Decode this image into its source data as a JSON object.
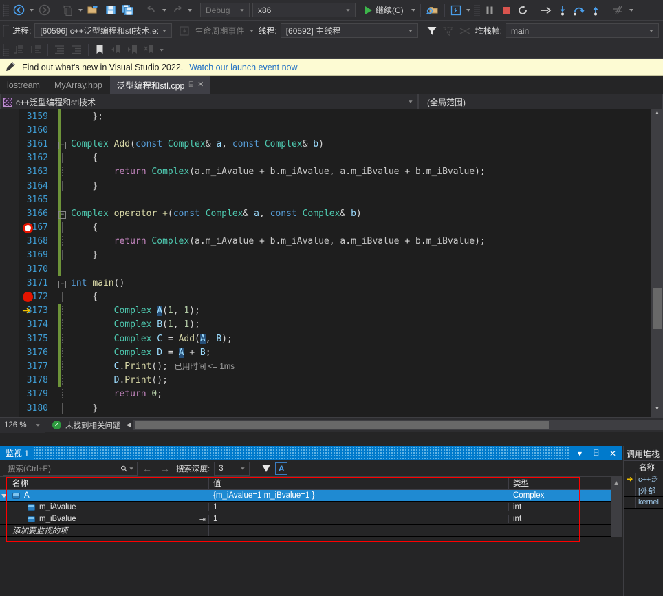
{
  "toolbar_main": {
    "nav_back": "navigate-back",
    "nav_forward": "navigate-forward",
    "new_item": "new-item",
    "open_file": "open-file",
    "save": "save",
    "save_all": "save-all",
    "undo": "undo",
    "redo": "redo",
    "config": "Debug",
    "platform": "x86",
    "continue_label": "继续(C)",
    "attach": "attach-to-process",
    "hot_reload": "hot-reload",
    "break_all": "break-all",
    "stop": "stop-debugging",
    "restart": "restart",
    "show_next": "show-next-statement",
    "step_into": "step-into",
    "step_over": "step-over",
    "step_out": "step-out",
    "threads_win": "threads-window"
  },
  "toolbar_debug": {
    "process_label": "进程:",
    "process_value": "[60596] c++泛型编程和stl技术.e:",
    "lifecycle_label": "生命周期事件",
    "thread_label": "线程:",
    "thread_value": "[60592] 主线程",
    "stackframe_label": "堆栈帧:",
    "stackframe_value": "main"
  },
  "toolbar_text": {
    "comment": "comment-selection",
    "uncomment": "uncomment-selection",
    "indent": "increase-indent",
    "outdent": "decrease-indent",
    "bookmark": "toggle-bookmark",
    "prev_bookmark": "previous-bookmark",
    "next_bookmark": "next-bookmark",
    "clear_bookmarks": "clear-bookmarks"
  },
  "notification": {
    "text": "Find out what's new in Visual Studio 2022.",
    "link": "Watch our launch event now"
  },
  "tabs": [
    {
      "label": "iostream",
      "active": false
    },
    {
      "label": "MyArray.hpp",
      "active": false
    },
    {
      "label": "泛型编程和stl.cpp",
      "active": true
    }
  ],
  "navbar": {
    "project": "c++泛型编程和stl技术",
    "scope": "(全局范围)"
  },
  "editor": {
    "zoom": "126 %",
    "status": "未找到相关问题",
    "lines": [
      {
        "num": "3159",
        "changed": true,
        "marker": "",
        "fold": "",
        "guide": "",
        "tokens": [
          {
            "c": "p",
            "t": "};"
          }
        ],
        "indent": 1
      },
      {
        "num": "3160",
        "changed": true,
        "marker": "",
        "fold": "",
        "guide": "",
        "tokens": [],
        "indent": 0
      },
      {
        "num": "3161",
        "changed": true,
        "marker": "",
        "fold": "-",
        "guide": "",
        "tokens": [
          {
            "c": "t",
            "t": "Complex"
          },
          {
            "c": "p",
            "t": " "
          },
          {
            "c": "f",
            "t": "Add"
          },
          {
            "c": "p",
            "t": "("
          },
          {
            "c": "k",
            "t": "const"
          },
          {
            "c": "p",
            "t": " "
          },
          {
            "c": "t",
            "t": "Complex"
          },
          {
            "c": "p",
            "t": "& "
          },
          {
            "c": "v",
            "t": "a"
          },
          {
            "c": "p",
            "t": ", "
          },
          {
            "c": "k",
            "t": "const"
          },
          {
            "c": "p",
            "t": " "
          },
          {
            "c": "t",
            "t": "Complex"
          },
          {
            "c": "p",
            "t": "& "
          },
          {
            "c": "v",
            "t": "b"
          },
          {
            "c": "p",
            "t": ")"
          }
        ],
        "indent": 0
      },
      {
        "num": "3162",
        "changed": true,
        "marker": "",
        "fold": "",
        "guide": "solid",
        "tokens": [
          {
            "c": "p",
            "t": "{"
          }
        ],
        "indent": 1
      },
      {
        "num": "3163",
        "changed": true,
        "marker": "",
        "fold": "",
        "guide": "dash",
        "tokens": [
          {
            "c": "kr",
            "t": "return"
          },
          {
            "c": "p",
            "t": " "
          },
          {
            "c": "t",
            "t": "Complex"
          },
          {
            "c": "p",
            "t": "("
          },
          {
            "c": "m",
            "t": "a"
          },
          {
            "c": "p",
            "t": "."
          },
          {
            "c": "m",
            "t": "m_iAvalue"
          },
          {
            "c": "p",
            "t": " + "
          },
          {
            "c": "m",
            "t": "b"
          },
          {
            "c": "p",
            "t": "."
          },
          {
            "c": "m",
            "t": "m_iAvalue"
          },
          {
            "c": "p",
            "t": ", "
          },
          {
            "c": "m",
            "t": "a"
          },
          {
            "c": "p",
            "t": "."
          },
          {
            "c": "m",
            "t": "m_iBvalue"
          },
          {
            "c": "p",
            "t": " + "
          },
          {
            "c": "m",
            "t": "b"
          },
          {
            "c": "p",
            "t": "."
          },
          {
            "c": "m",
            "t": "m_iBvalue"
          },
          {
            "c": "p",
            "t": ");"
          }
        ],
        "indent": 2
      },
      {
        "num": "3164",
        "changed": true,
        "marker": "",
        "fold": "",
        "guide": "solid",
        "tokens": [
          {
            "c": "p",
            "t": "}"
          }
        ],
        "indent": 1
      },
      {
        "num": "3165",
        "changed": true,
        "marker": "",
        "fold": "",
        "guide": "",
        "tokens": [],
        "indent": 0
      },
      {
        "num": "3166",
        "changed": true,
        "marker": "",
        "fold": "-",
        "guide": "",
        "tokens": [
          {
            "c": "t",
            "t": "Complex"
          },
          {
            "c": "p",
            "t": " "
          },
          {
            "c": "f",
            "t": "operator +"
          },
          {
            "c": "p",
            "t": "("
          },
          {
            "c": "k",
            "t": "const"
          },
          {
            "c": "p",
            "t": " "
          },
          {
            "c": "t",
            "t": "Complex"
          },
          {
            "c": "p",
            "t": "& "
          },
          {
            "c": "v",
            "t": "a"
          },
          {
            "c": "p",
            "t": ", "
          },
          {
            "c": "k",
            "t": "const"
          },
          {
            "c": "p",
            "t": " "
          },
          {
            "c": "t",
            "t": "Complex"
          },
          {
            "c": "p",
            "t": "& "
          },
          {
            "c": "v",
            "t": "b"
          },
          {
            "c": "p",
            "t": ")"
          }
        ],
        "indent": 0
      },
      {
        "num": "3167",
        "changed": true,
        "marker": "hollow",
        "fold": "",
        "guide": "solid",
        "tokens": [
          {
            "c": "p",
            "t": "{"
          }
        ],
        "indent": 1
      },
      {
        "num": "3168",
        "changed": true,
        "marker": "",
        "fold": "",
        "guide": "dash",
        "tokens": [
          {
            "c": "kr",
            "t": "return"
          },
          {
            "c": "p",
            "t": " "
          },
          {
            "c": "t",
            "t": "Complex"
          },
          {
            "c": "p",
            "t": "("
          },
          {
            "c": "m",
            "t": "a"
          },
          {
            "c": "p",
            "t": "."
          },
          {
            "c": "m",
            "t": "m_iAvalue"
          },
          {
            "c": "p",
            "t": " + "
          },
          {
            "c": "m",
            "t": "b"
          },
          {
            "c": "p",
            "t": "."
          },
          {
            "c": "m",
            "t": "m_iAvalue"
          },
          {
            "c": "p",
            "t": ", "
          },
          {
            "c": "m",
            "t": "a"
          },
          {
            "c": "p",
            "t": "."
          },
          {
            "c": "m",
            "t": "m_iBvalue"
          },
          {
            "c": "p",
            "t": " + "
          },
          {
            "c": "m",
            "t": "b"
          },
          {
            "c": "p",
            "t": "."
          },
          {
            "c": "m",
            "t": "m_iBvalue"
          },
          {
            "c": "p",
            "t": ");"
          }
        ],
        "indent": 2
      },
      {
        "num": "3169",
        "changed": true,
        "marker": "",
        "fold": "",
        "guide": "solid",
        "tokens": [
          {
            "c": "p",
            "t": "}"
          }
        ],
        "indent": 1
      },
      {
        "num": "3170",
        "changed": true,
        "marker": "",
        "fold": "",
        "guide": "",
        "tokens": [],
        "indent": 0
      },
      {
        "num": "3171",
        "changed": false,
        "marker": "",
        "fold": "-",
        "guide": "",
        "tokens": [
          {
            "c": "k",
            "t": "int"
          },
          {
            "c": "p",
            "t": " "
          },
          {
            "c": "f",
            "t": "main"
          },
          {
            "c": "p",
            "t": "()"
          }
        ],
        "indent": 0
      },
      {
        "num": "3172",
        "changed": false,
        "marker": "full",
        "fold": "",
        "guide": "solid",
        "tokens": [
          {
            "c": "p",
            "t": "{"
          }
        ],
        "indent": 1
      },
      {
        "num": "3173",
        "changed": true,
        "marker": "arrow",
        "fold": "",
        "guide": "dash",
        "tokens": [
          {
            "c": "t",
            "t": "Complex"
          },
          {
            "c": "p",
            "t": " "
          },
          {
            "c": "sel",
            "t": "A"
          },
          {
            "c": "p",
            "t": "("
          },
          {
            "c": "n",
            "t": "1"
          },
          {
            "c": "p",
            "t": ", "
          },
          {
            "c": "n",
            "t": "1"
          },
          {
            "c": "p",
            "t": ");"
          }
        ],
        "indent": 2
      },
      {
        "num": "3174",
        "changed": true,
        "marker": "",
        "fold": "",
        "guide": "dash",
        "tokens": [
          {
            "c": "t",
            "t": "Complex"
          },
          {
            "c": "p",
            "t": " "
          },
          {
            "c": "v",
            "t": "B"
          },
          {
            "c": "p",
            "t": "("
          },
          {
            "c": "n",
            "t": "1"
          },
          {
            "c": "p",
            "t": ", "
          },
          {
            "c": "n",
            "t": "1"
          },
          {
            "c": "p",
            "t": ");"
          }
        ],
        "indent": 2
      },
      {
        "num": "3175",
        "changed": true,
        "marker": "",
        "fold": "",
        "guide": "dash",
        "tokens": [
          {
            "c": "t",
            "t": "Complex"
          },
          {
            "c": "p",
            "t": " "
          },
          {
            "c": "v",
            "t": "C"
          },
          {
            "c": "p",
            "t": " = "
          },
          {
            "c": "f",
            "t": "Add"
          },
          {
            "c": "p",
            "t": "("
          },
          {
            "c": "sel",
            "t": "A"
          },
          {
            "c": "p",
            "t": ", "
          },
          {
            "c": "v",
            "t": "B"
          },
          {
            "c": "p",
            "t": ");"
          }
        ],
        "indent": 2
      },
      {
        "num": "3176",
        "changed": true,
        "marker": "",
        "fold": "",
        "guide": "dash",
        "tokens": [
          {
            "c": "t",
            "t": "Complex"
          },
          {
            "c": "p",
            "t": " "
          },
          {
            "c": "v",
            "t": "D"
          },
          {
            "c": "p",
            "t": " = "
          },
          {
            "c": "sel",
            "t": "A"
          },
          {
            "c": "p",
            "t": " + "
          },
          {
            "c": "v",
            "t": "B"
          },
          {
            "c": "p",
            "t": ";"
          }
        ],
        "indent": 2
      },
      {
        "num": "3177",
        "changed": true,
        "marker": "",
        "fold": "",
        "guide": "dash",
        "tokens": [
          {
            "c": "v",
            "t": "C"
          },
          {
            "c": "p",
            "t": "."
          },
          {
            "c": "f",
            "t": "Print"
          },
          {
            "c": "p",
            "t": "();"
          },
          {
            "c": "hint",
            "t": "   已用时间 <= 1ms"
          }
        ],
        "indent": 2
      },
      {
        "num": "3178",
        "changed": true,
        "marker": "",
        "fold": "",
        "guide": "dash",
        "tokens": [
          {
            "c": "v",
            "t": "D"
          },
          {
            "c": "p",
            "t": "."
          },
          {
            "c": "f",
            "t": "Print"
          },
          {
            "c": "p",
            "t": "();"
          }
        ],
        "indent": 2
      },
      {
        "num": "3179",
        "changed": false,
        "marker": "",
        "fold": "",
        "guide": "dash",
        "tokens": [
          {
            "c": "kr",
            "t": "return"
          },
          {
            "c": "p",
            "t": " "
          },
          {
            "c": "n",
            "t": "0"
          },
          {
            "c": "p",
            "t": ";"
          }
        ],
        "indent": 2
      },
      {
        "num": "3180",
        "changed": false,
        "marker": "",
        "fold": "",
        "guide": "solid",
        "tokens": [
          {
            "c": "p",
            "t": "}"
          }
        ],
        "indent": 1
      }
    ]
  },
  "watch": {
    "title": "监视 1",
    "search_placeholder": "搜索(Ctrl+E)",
    "depth_label": "搜索深度:",
    "depth_value": "3",
    "match_case_label": "A",
    "columns": [
      "名称",
      "值",
      "类型"
    ],
    "rows": [
      {
        "name": "A",
        "value": "{m_iAvalue=1 m_iBvalue=1 }",
        "type": "Complex",
        "level": 0,
        "expanded": true,
        "selected": true,
        "refresh": false
      },
      {
        "name": "m_iAvalue",
        "value": "1",
        "type": "int",
        "level": 1,
        "expanded": false,
        "selected": false,
        "refresh": false
      },
      {
        "name": "m_iBvalue",
        "value": "1",
        "type": "int",
        "level": 1,
        "expanded": false,
        "selected": false,
        "refresh": true
      }
    ],
    "add_row_placeholder": "添加要监视的项"
  },
  "callstack": {
    "title": "调用堆栈",
    "column": "名称",
    "rows": [
      {
        "text": "c++泛",
        "current": true
      },
      {
        "text": "[外部",
        "current": false
      },
      {
        "text": "kernel",
        "current": false
      }
    ]
  },
  "colors": {
    "accent": "#007acc",
    "notification_bg": "#fdfbd3",
    "breakpoint": "#e51400",
    "current_line_arrow": "#f0c000",
    "highlight_box": "#fe0000",
    "change_bar": "#6d9339",
    "selection": "#264f78"
  }
}
